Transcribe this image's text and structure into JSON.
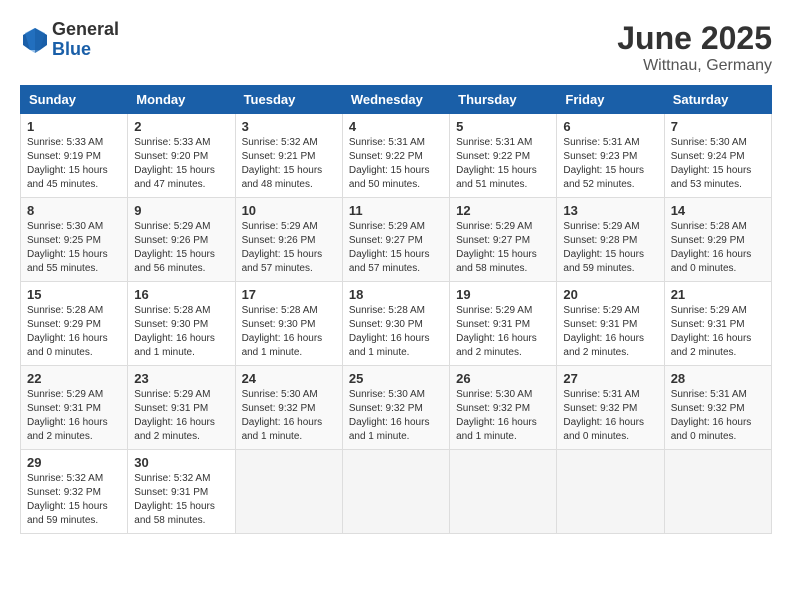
{
  "logo": {
    "general": "General",
    "blue": "Blue"
  },
  "title": "June 2025",
  "location": "Wittnau, Germany",
  "weekdays": [
    "Sunday",
    "Monday",
    "Tuesday",
    "Wednesday",
    "Thursday",
    "Friday",
    "Saturday"
  ],
  "weeks": [
    [
      {
        "day": "1",
        "sunrise": "Sunrise: 5:33 AM",
        "sunset": "Sunset: 9:19 PM",
        "daylight": "Daylight: 15 hours and 45 minutes."
      },
      {
        "day": "2",
        "sunrise": "Sunrise: 5:33 AM",
        "sunset": "Sunset: 9:20 PM",
        "daylight": "Daylight: 15 hours and 47 minutes."
      },
      {
        "day": "3",
        "sunrise": "Sunrise: 5:32 AM",
        "sunset": "Sunset: 9:21 PM",
        "daylight": "Daylight: 15 hours and 48 minutes."
      },
      {
        "day": "4",
        "sunrise": "Sunrise: 5:31 AM",
        "sunset": "Sunset: 9:22 PM",
        "daylight": "Daylight: 15 hours and 50 minutes."
      },
      {
        "day": "5",
        "sunrise": "Sunrise: 5:31 AM",
        "sunset": "Sunset: 9:22 PM",
        "daylight": "Daylight: 15 hours and 51 minutes."
      },
      {
        "day": "6",
        "sunrise": "Sunrise: 5:31 AM",
        "sunset": "Sunset: 9:23 PM",
        "daylight": "Daylight: 15 hours and 52 minutes."
      },
      {
        "day": "7",
        "sunrise": "Sunrise: 5:30 AM",
        "sunset": "Sunset: 9:24 PM",
        "daylight": "Daylight: 15 hours and 53 minutes."
      }
    ],
    [
      {
        "day": "8",
        "sunrise": "Sunrise: 5:30 AM",
        "sunset": "Sunset: 9:25 PM",
        "daylight": "Daylight: 15 hours and 55 minutes."
      },
      {
        "day": "9",
        "sunrise": "Sunrise: 5:29 AM",
        "sunset": "Sunset: 9:26 PM",
        "daylight": "Daylight: 15 hours and 56 minutes."
      },
      {
        "day": "10",
        "sunrise": "Sunrise: 5:29 AM",
        "sunset": "Sunset: 9:26 PM",
        "daylight": "Daylight: 15 hours and 57 minutes."
      },
      {
        "day": "11",
        "sunrise": "Sunrise: 5:29 AM",
        "sunset": "Sunset: 9:27 PM",
        "daylight": "Daylight: 15 hours and 57 minutes."
      },
      {
        "day": "12",
        "sunrise": "Sunrise: 5:29 AM",
        "sunset": "Sunset: 9:27 PM",
        "daylight": "Daylight: 15 hours and 58 minutes."
      },
      {
        "day": "13",
        "sunrise": "Sunrise: 5:29 AM",
        "sunset": "Sunset: 9:28 PM",
        "daylight": "Daylight: 15 hours and 59 minutes."
      },
      {
        "day": "14",
        "sunrise": "Sunrise: 5:28 AM",
        "sunset": "Sunset: 9:29 PM",
        "daylight": "Daylight: 16 hours and 0 minutes."
      }
    ],
    [
      {
        "day": "15",
        "sunrise": "Sunrise: 5:28 AM",
        "sunset": "Sunset: 9:29 PM",
        "daylight": "Daylight: 16 hours and 0 minutes."
      },
      {
        "day": "16",
        "sunrise": "Sunrise: 5:28 AM",
        "sunset": "Sunset: 9:30 PM",
        "daylight": "Daylight: 16 hours and 1 minute."
      },
      {
        "day": "17",
        "sunrise": "Sunrise: 5:28 AM",
        "sunset": "Sunset: 9:30 PM",
        "daylight": "Daylight: 16 hours and 1 minute."
      },
      {
        "day": "18",
        "sunrise": "Sunrise: 5:28 AM",
        "sunset": "Sunset: 9:30 PM",
        "daylight": "Daylight: 16 hours and 1 minute."
      },
      {
        "day": "19",
        "sunrise": "Sunrise: 5:29 AM",
        "sunset": "Sunset: 9:31 PM",
        "daylight": "Daylight: 16 hours and 2 minutes."
      },
      {
        "day": "20",
        "sunrise": "Sunrise: 5:29 AM",
        "sunset": "Sunset: 9:31 PM",
        "daylight": "Daylight: 16 hours and 2 minutes."
      },
      {
        "day": "21",
        "sunrise": "Sunrise: 5:29 AM",
        "sunset": "Sunset: 9:31 PM",
        "daylight": "Daylight: 16 hours and 2 minutes."
      }
    ],
    [
      {
        "day": "22",
        "sunrise": "Sunrise: 5:29 AM",
        "sunset": "Sunset: 9:31 PM",
        "daylight": "Daylight: 16 hours and 2 minutes."
      },
      {
        "day": "23",
        "sunrise": "Sunrise: 5:29 AM",
        "sunset": "Sunset: 9:31 PM",
        "daylight": "Daylight: 16 hours and 2 minutes."
      },
      {
        "day": "24",
        "sunrise": "Sunrise: 5:30 AM",
        "sunset": "Sunset: 9:32 PM",
        "daylight": "Daylight: 16 hours and 1 minute."
      },
      {
        "day": "25",
        "sunrise": "Sunrise: 5:30 AM",
        "sunset": "Sunset: 9:32 PM",
        "daylight": "Daylight: 16 hours and 1 minute."
      },
      {
        "day": "26",
        "sunrise": "Sunrise: 5:30 AM",
        "sunset": "Sunset: 9:32 PM",
        "daylight": "Daylight: 16 hours and 1 minute."
      },
      {
        "day": "27",
        "sunrise": "Sunrise: 5:31 AM",
        "sunset": "Sunset: 9:32 PM",
        "daylight": "Daylight: 16 hours and 0 minutes."
      },
      {
        "day": "28",
        "sunrise": "Sunrise: 5:31 AM",
        "sunset": "Sunset: 9:32 PM",
        "daylight": "Daylight: 16 hours and 0 minutes."
      }
    ],
    [
      {
        "day": "29",
        "sunrise": "Sunrise: 5:32 AM",
        "sunset": "Sunset: 9:32 PM",
        "daylight": "Daylight: 15 hours and 59 minutes."
      },
      {
        "day": "30",
        "sunrise": "Sunrise: 5:32 AM",
        "sunset": "Sunset: 9:31 PM",
        "daylight": "Daylight: 15 hours and 58 minutes."
      },
      null,
      null,
      null,
      null,
      null
    ]
  ]
}
